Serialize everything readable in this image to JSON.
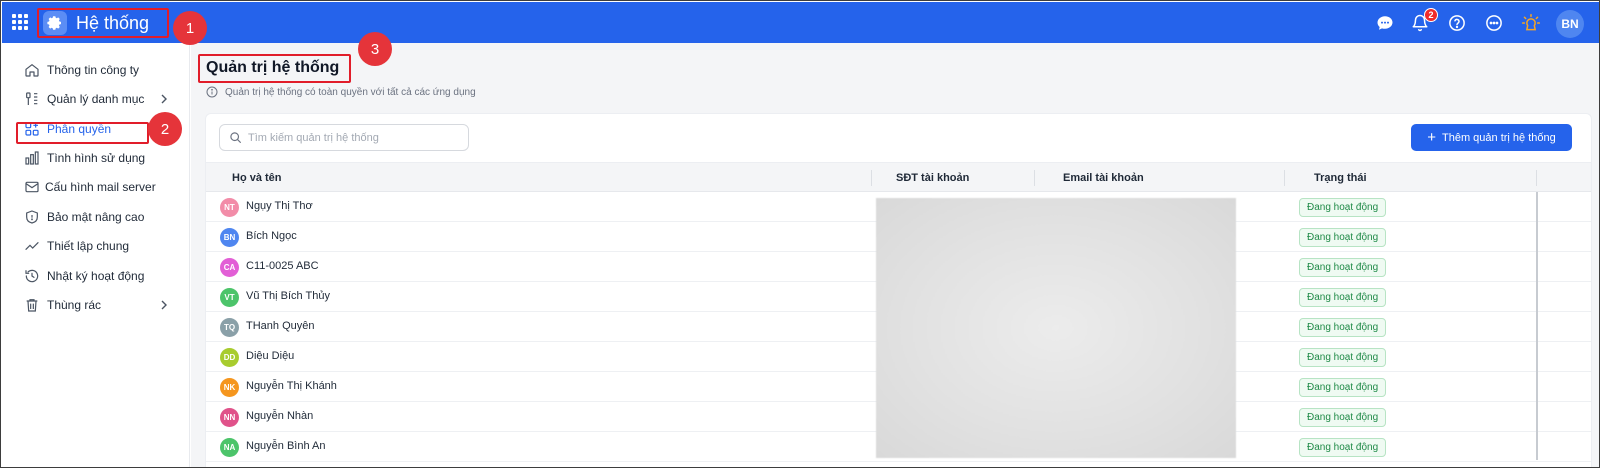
{
  "header": {
    "app_title": "Hệ thống",
    "notification_count": "2",
    "user_initials": "BN",
    "colors": {
      "bar": "#2563eb",
      "accent_red": "#e11d2a"
    },
    "icons": [
      "apps-grid-icon",
      "settings-gear-icon",
      "chat-icon",
      "bell-icon",
      "help-icon",
      "more-icon",
      "lightbulb-icon"
    ]
  },
  "markers": [
    "1",
    "2",
    "3"
  ],
  "sidebar": {
    "items": [
      {
        "label": "Thông tin công ty",
        "icon": "home-icon"
      },
      {
        "label": "Quản lý danh mục",
        "icon": "catalog-icon",
        "has_children": true
      },
      {
        "label": "Phân quyền",
        "icon": "permission-icon",
        "active": true
      },
      {
        "label": "Tình hình sử dụng",
        "icon": "usage-chart-icon"
      },
      {
        "label": "Cấu hình mail server",
        "icon": "mail-icon"
      },
      {
        "label": "Bảo mật nâng cao",
        "icon": "shield-icon"
      },
      {
        "label": "Thiết lập chung",
        "icon": "trend-icon"
      },
      {
        "label": "Nhật ký hoạt động",
        "icon": "history-icon"
      },
      {
        "label": "Thùng rác",
        "icon": "trash-icon",
        "has_children": true
      }
    ]
  },
  "main": {
    "title": "Quản trị hệ thống",
    "description": "Quản trị hệ thống có toàn quyền với tất cả các ứng dụng",
    "search_placeholder": "Tìm kiếm quản trị hệ thống",
    "add_button_label": "Thêm quản trị hệ thống",
    "columns": [
      "Họ và tên",
      "SĐT tài khoản",
      "Email tài khoản",
      "Trạng thái"
    ],
    "rows": [
      {
        "initials": "NT",
        "name": "Ngụy Thị Thơ",
        "status": "Đang hoạt động",
        "color": "#f28ca8"
      },
      {
        "initials": "BN",
        "name": "Bích Ngọc",
        "status": "Đang hoạt động",
        "color": "#4f86f0"
      },
      {
        "initials": "CA",
        "name": "C11-0025 ABC",
        "status": "Đang hoạt động",
        "color": "#e25fd6"
      },
      {
        "initials": "VT",
        "name": "Vũ Thị Bích Thủy",
        "status": "Đang hoạt động",
        "color": "#4cc46a"
      },
      {
        "initials": "TQ",
        "name": "THanh Quyên",
        "status": "Đang hoạt động",
        "color": "#8aa0a8"
      },
      {
        "initials": "DD",
        "name": "Diệu Diệu",
        "status": "Đang hoạt động",
        "color": "#a8cc2e"
      },
      {
        "initials": "NK",
        "name": "Nguyễn Thị Khánh",
        "status": "Đang hoạt động",
        "color": "#f5961e"
      },
      {
        "initials": "NN",
        "name": "Nguyễn Nhàn",
        "status": "Đang hoạt động",
        "color": "#e0528a"
      },
      {
        "initials": "NA",
        "name": "Nguyễn Bình An",
        "status": "Đang hoạt động",
        "color": "#4cc46a"
      }
    ],
    "status_color": "#1f8a47"
  }
}
